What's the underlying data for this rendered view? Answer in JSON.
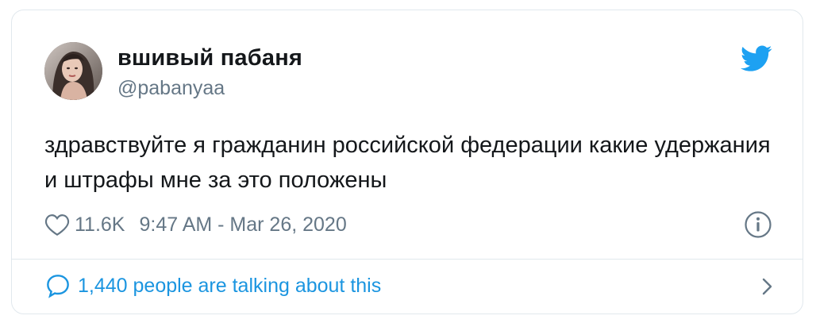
{
  "tweet": {
    "author": {
      "display_name": "вшивый пабаня",
      "handle": "@pabanyaa",
      "avatar_icon": "user-avatar"
    },
    "text": "здравствуйте я гражданин российской федерации какие удержания и штрафы мне за это положены",
    "likes": "11.6K",
    "timestamp": "9:47 AM - Mar 26, 2020",
    "talking_label": "1,440 people are talking about this",
    "icons": {
      "brand": "twitter-bird-icon",
      "like": "heart-icon",
      "info": "info-icon",
      "conversation": "speech-bubble-icon",
      "navigate": "chevron-right-icon"
    },
    "colors": {
      "brand_blue": "#1da1f2",
      "link_blue": "#1b95e0",
      "secondary_gray": "#657786",
      "text": "#14171a",
      "border": "#e1e8ed"
    }
  }
}
